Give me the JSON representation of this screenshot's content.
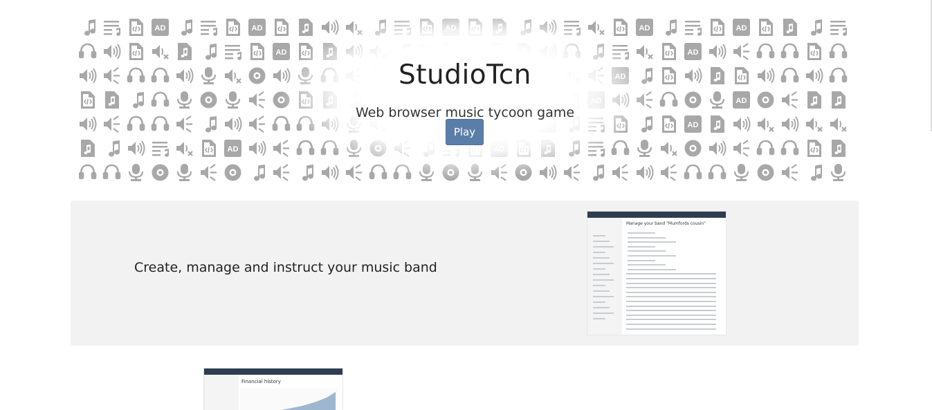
{
  "hero": {
    "title": "StudioTcn",
    "subtitle": "Web browser music tycoon game",
    "play_label": "Play"
  },
  "features": [
    {
      "text": "Create, manage and instruct your music band"
    }
  ],
  "screenshots": [
    {
      "heading": "Manage your band \"Mumfords cousin\""
    },
    {
      "heading": "Financial history"
    }
  ],
  "icons": [
    "music-note-icon",
    "playlist-icon",
    "audio-file-icon",
    "ad-icon",
    "volume-icon",
    "volume-mute-icon",
    "headset-icon",
    "microphone-icon",
    "vinyl-disc-icon",
    "equalizer-icon",
    "music-file-icon"
  ],
  "colors": {
    "icon_gray": "#a8a8a8",
    "play_button": "#5a7ea8",
    "feature_bg": "#f2f2f2"
  }
}
